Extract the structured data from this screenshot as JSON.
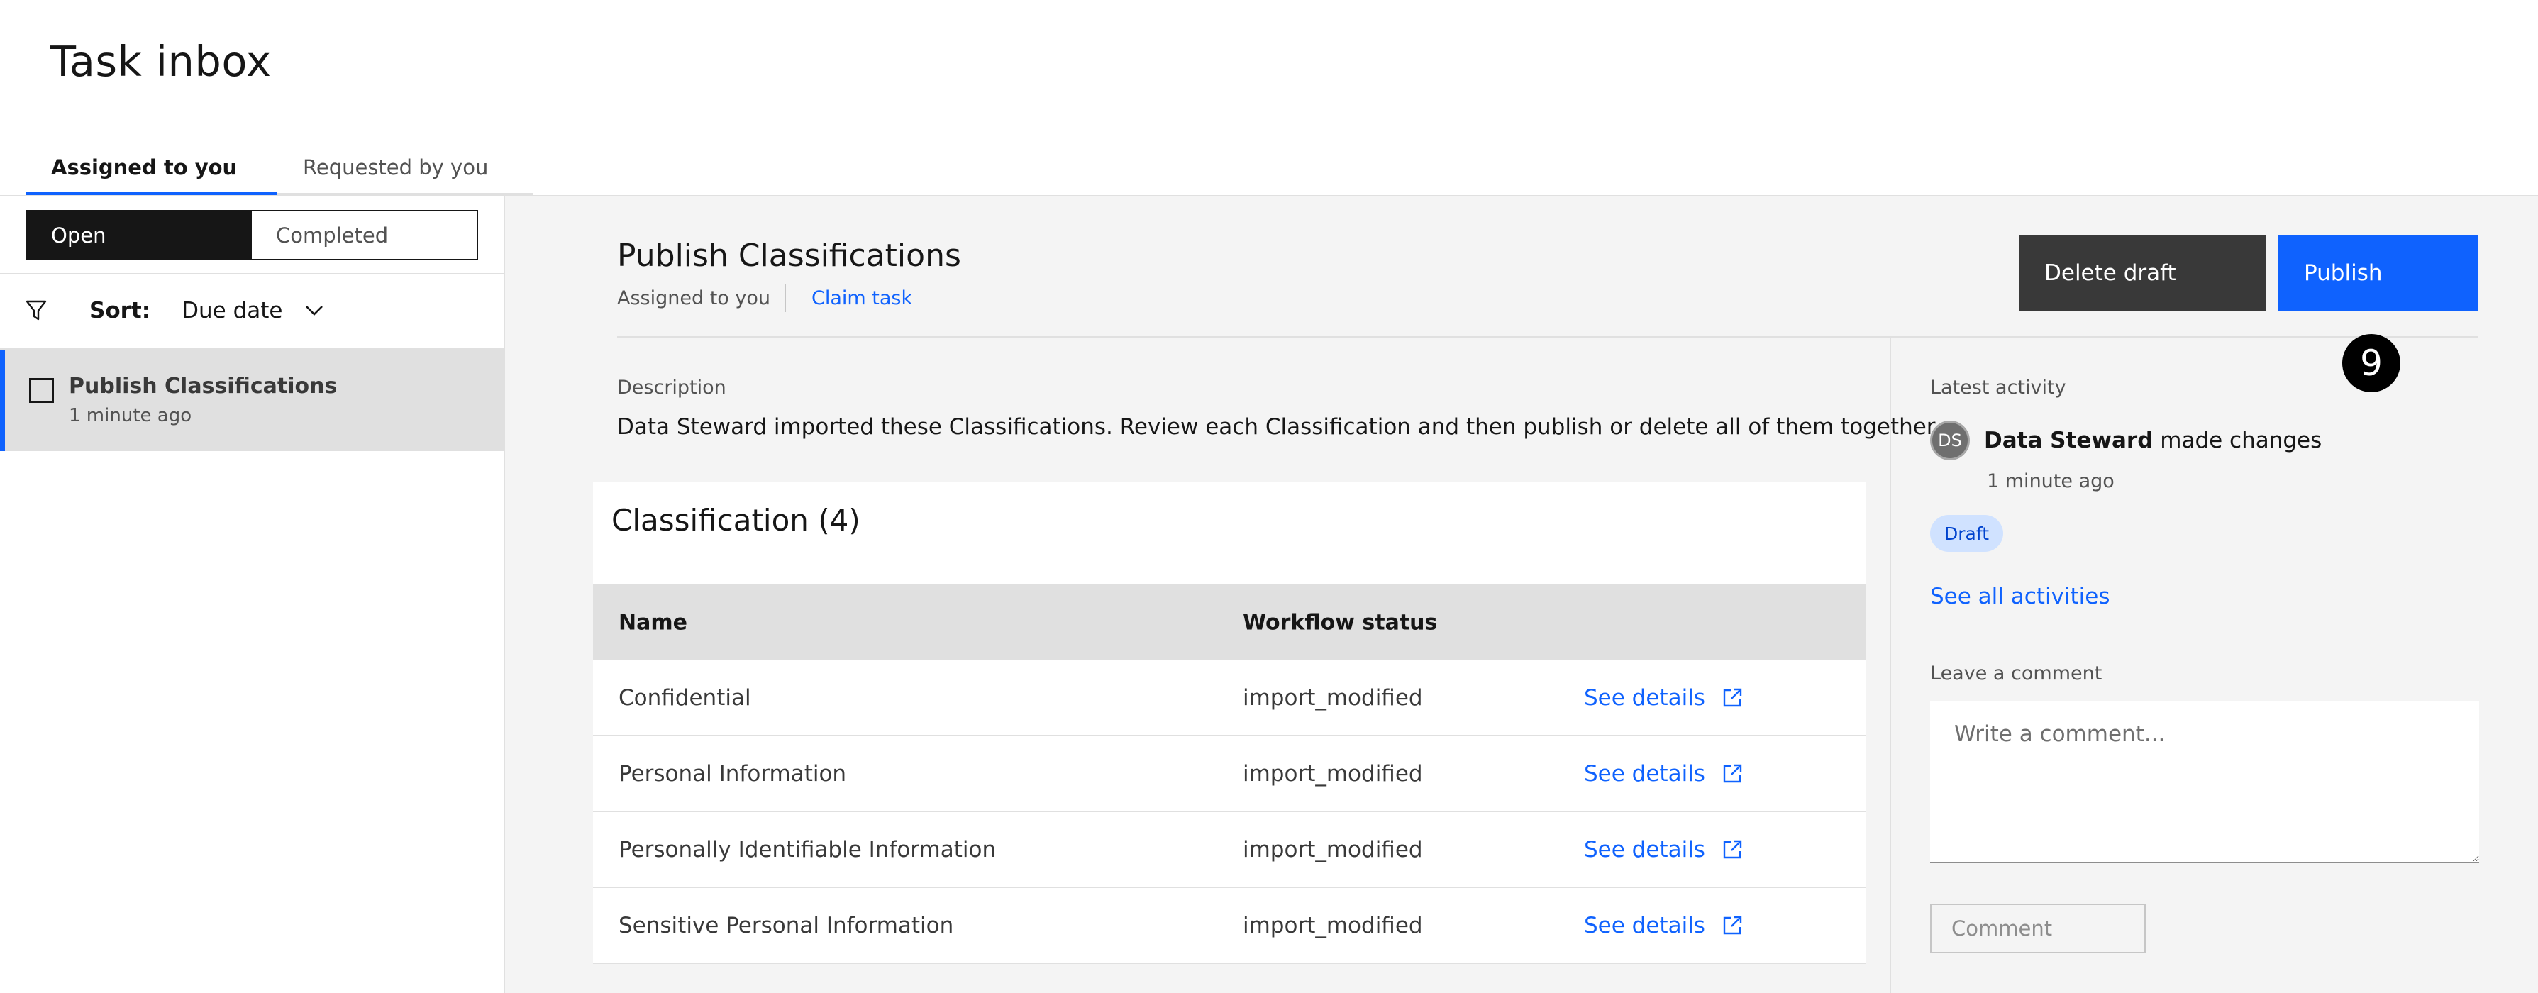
{
  "page": {
    "title": "Task inbox"
  },
  "tabs": [
    {
      "label": "Assigned to you",
      "active": true
    },
    {
      "label": "Requested by you",
      "active": false
    }
  ],
  "sidebar": {
    "segments": [
      {
        "label": "Open",
        "active": true
      },
      {
        "label": "Completed",
        "active": false
      }
    ],
    "sort": {
      "label": "Sort:",
      "value": "Due date"
    },
    "tasks": [
      {
        "title": "Publish Classifications",
        "time": "1 minute ago",
        "selected": true
      }
    ]
  },
  "detail": {
    "title": "Publish Classifications",
    "assigned": "Assigned to you",
    "claim": "Claim task",
    "buttons": {
      "delete": "Delete draft",
      "publish": "Publish"
    },
    "badge": "9",
    "description_label": "Description",
    "description": "Data Steward imported these Classifications. Review each Classification and then publish or delete all of them together.",
    "classification": {
      "title": "Classification (4)",
      "columns": [
        "Name",
        "Workflow status"
      ],
      "rows": [
        {
          "name": "Confidential",
          "status": "import_modified",
          "link": "See details"
        },
        {
          "name": "Personal Information",
          "status": "import_modified",
          "link": "See details"
        },
        {
          "name": "Personally Identifiable Information",
          "status": "import_modified",
          "link": "See details"
        },
        {
          "name": "Sensitive Personal Information",
          "status": "import_modified",
          "link": "See details"
        }
      ]
    }
  },
  "activity": {
    "label": "Latest activity",
    "avatar": "DS",
    "user": "Data Steward",
    "action": " made changes",
    "time": "1 minute ago",
    "tag": "Draft",
    "see_all": "See all activities",
    "comment_label": "Leave a comment",
    "comment_placeholder": "Write a comment...",
    "comment_button": "Comment"
  },
  "colors": {
    "accent": "#0f62fe",
    "dark": "#161616",
    "button_secondary": "#393939",
    "tag_bg": "#d0e2ff"
  },
  "icons": [
    "filter-icon",
    "chevron-down-icon",
    "checkbox-icon",
    "external-link-icon"
  ]
}
